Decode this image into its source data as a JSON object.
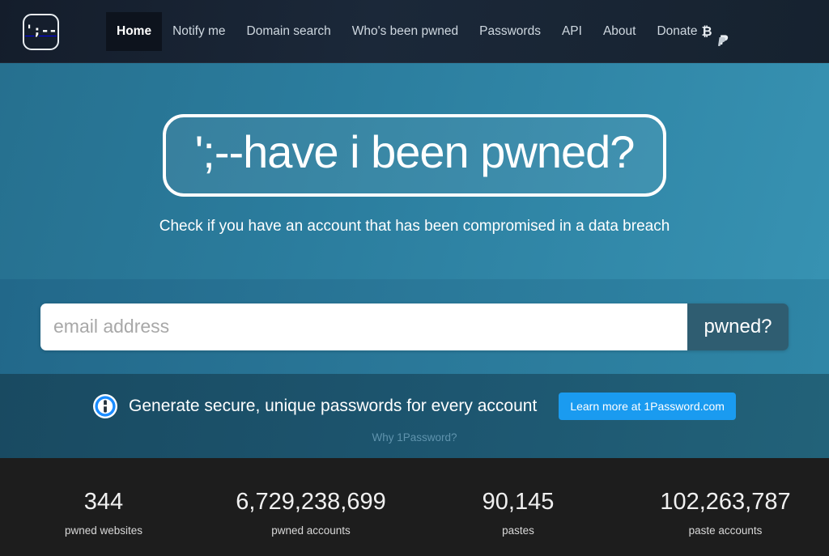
{
  "header": {
    "logo_text": "';--",
    "logo_name": "have-i-been-pwned-logo",
    "nav": [
      {
        "label": "Home",
        "active": true
      },
      {
        "label": "Notify me",
        "active": false
      },
      {
        "label": "Domain search",
        "active": false
      },
      {
        "label": "Who's been pwned",
        "active": false
      },
      {
        "label": "Passwords",
        "active": false
      },
      {
        "label": "API",
        "active": false
      },
      {
        "label": "About",
        "active": false
      }
    ],
    "donate": {
      "label": "Donate",
      "bitcoin_glyph": "₿",
      "icons": [
        "bitcoin-icon",
        "paypal-icon"
      ]
    },
    "background_color": "#192231",
    "active_tab_color": "#0d131d"
  },
  "hero": {
    "title": "';--have i been pwned?",
    "subtitle": "Check if you have an account that has been compromised in a data breach",
    "background_color": "#2b7d9e"
  },
  "search": {
    "placeholder": "email address",
    "value": "",
    "button_label": "pwned?",
    "button_color": "#2f5d71",
    "background_color": "#2a7899"
  },
  "onepassword": {
    "headline": "Generate secure, unique passwords for every account",
    "cta_label": "Learn more at 1Password.com",
    "cta_color": "#1a9bf0",
    "why_link": "Why 1Password?",
    "background_color": "#1d5670"
  },
  "stats": {
    "background_color": "#1d1d1d",
    "items": [
      {
        "value": "344",
        "label": "pwned websites"
      },
      {
        "value": "6,729,238,699",
        "label": "pwned accounts"
      },
      {
        "value": "90,145",
        "label": "pastes"
      },
      {
        "value": "102,263,787",
        "label": "paste accounts"
      }
    ]
  }
}
